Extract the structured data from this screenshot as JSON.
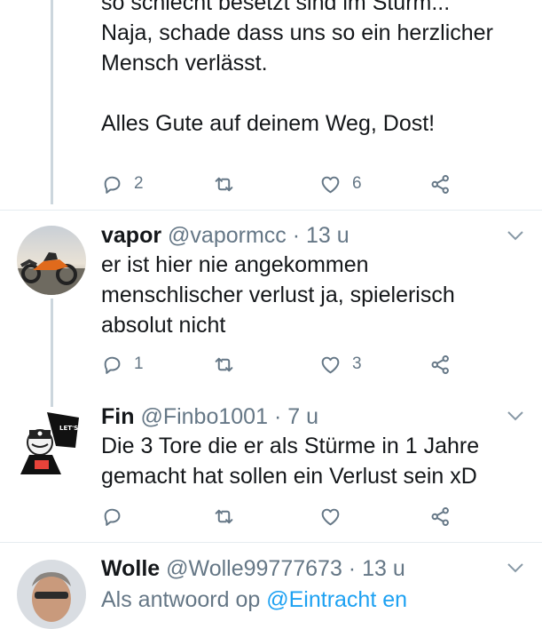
{
  "thread_prev": {
    "lines": [
      "so schlecht besetzt sind im Sturm...",
      "Naja, schade dass uns so ein herzlicher",
      "Mensch verlässt.",
      "Alles Gute auf deinem Weg, Dost!"
    ],
    "actions": {
      "replies": "2",
      "likes": "6"
    }
  },
  "tweets": [
    {
      "name": "vapor",
      "handle": "@vapormcc",
      "dot": "·",
      "time": "13 u",
      "lines": [
        "er ist hier nie angekommen",
        "menschlischer verlust ja, spielerisch",
        "absolut nicht"
      ],
      "actions": {
        "replies": "1",
        "likes": "3"
      }
    },
    {
      "name": "Fin",
      "handle": "@Finbo1001",
      "dot": "·",
      "time": "7 u",
      "lines": [
        "Die 3 Tore die er als Stürme in 1 Jahre",
        "gemacht hat sollen ein Verlust sein xD"
      ],
      "avatar_text": "LET'S GO!",
      "actions": {}
    },
    {
      "name": "Wolle",
      "handle": "@Wolle99777673",
      "dot": "·",
      "time": "13 u",
      "replying_prefix": "Als antwoord op",
      "replying_mention": "@Eintracht en"
    }
  ],
  "icons": {
    "reply": "reply-icon",
    "retweet": "retweet-icon",
    "like": "heart-icon",
    "share": "share-icon",
    "caret": "chevron-down-icon"
  },
  "colors": {
    "secondary_text": "#657786",
    "link": "#1da1f2",
    "divider": "#e6ecf0",
    "thread": "#ccd6dd"
  }
}
